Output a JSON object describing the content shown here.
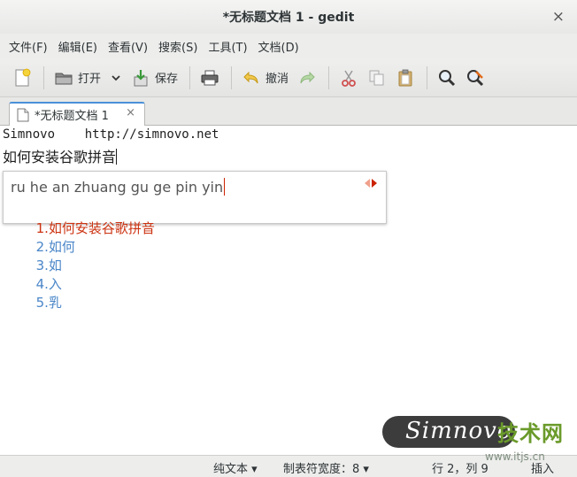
{
  "window": {
    "title": "*无标题文档 1 - gedit",
    "close_glyph": "×"
  },
  "menu": [
    "文件(F)",
    "编辑(E)",
    "查看(V)",
    "搜索(S)",
    "工具(T)",
    "文档(D)"
  ],
  "toolbar": {
    "open_label": "打开",
    "save_label": "保存",
    "undo_label": "撤消"
  },
  "tab": {
    "label": "*无标题文档 1",
    "close_glyph": "×"
  },
  "editor": {
    "line1": "Simnovo    http://simnovo.net",
    "line2": "如何安装谷歌拼音"
  },
  "ime": {
    "pinyin": "ru he an zhuang gu ge pin yin",
    "candidates": [
      "1.如何安装谷歌拼音",
      "2.如何",
      "3.如",
      "4.入",
      "5.乳"
    ],
    "colors": {
      "selected": "#cc3311",
      "other": "#4a86c8"
    }
  },
  "status": {
    "syntax": "纯文本 ▾",
    "tab_width": "制表符宽度：8 ▾",
    "position": "行 2，列 9",
    "mode": "插入"
  },
  "watermark": {
    "brand": "Simnovo",
    "site_cn": "技术网",
    "site_url": "www.itjs.cn"
  }
}
